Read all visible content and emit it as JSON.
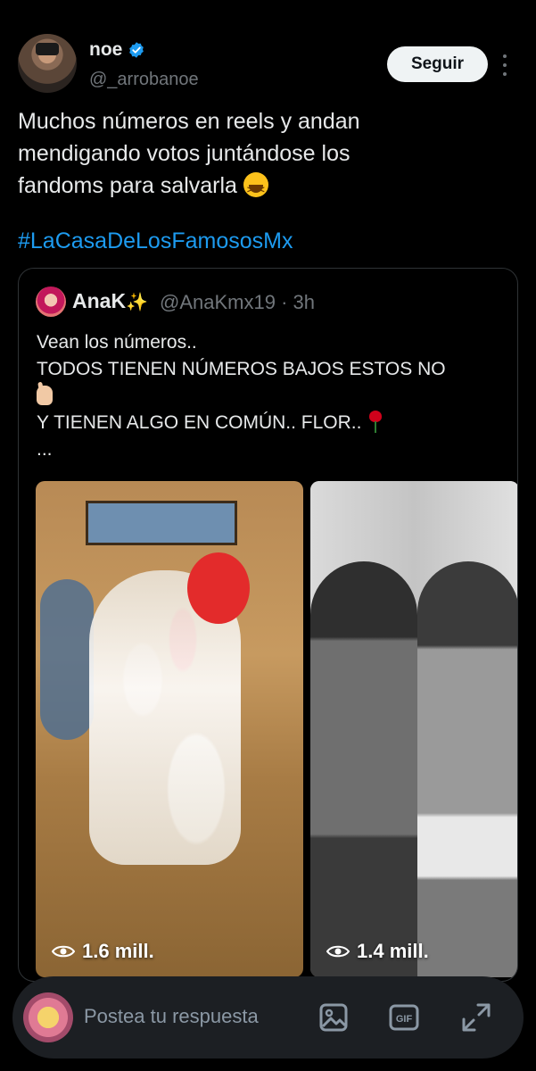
{
  "tweet": {
    "author_name": "noe",
    "author_handle": "@_arrobanoe",
    "follow_label": "Seguir",
    "text": "Muchos números en reels y andan\nmendigando votos juntándose los\nfandoms para salvarla ",
    "hashtag": "#LaCasaDeLosFamososMx"
  },
  "quote": {
    "author_name": "AnaK",
    "author_handle": "@AnaKmx19",
    "separator": "·",
    "time": "3h",
    "lines": [
      "Vean los números..",
      "TODOS TIENEN NÚMEROS BAJOS ESTOS NO",
      "",
      "Y TIENEN ALGO EN COMÚN.. FLOR.. ",
      "..."
    ],
    "media": [
      {
        "views": "1.6 mill."
      },
      {
        "views": "1.4 mill."
      }
    ]
  },
  "reply_bar": {
    "placeholder": "Postea tu respuesta",
    "icons": [
      "image-icon",
      "gif-icon",
      "expand-icon"
    ]
  },
  "colors": {
    "background": "#000000",
    "text": "#e7e9ea",
    "muted": "#71767b",
    "link": "#1d9bf0",
    "verified": "#1d9bf0",
    "follow_bg": "#eff3f4"
  }
}
